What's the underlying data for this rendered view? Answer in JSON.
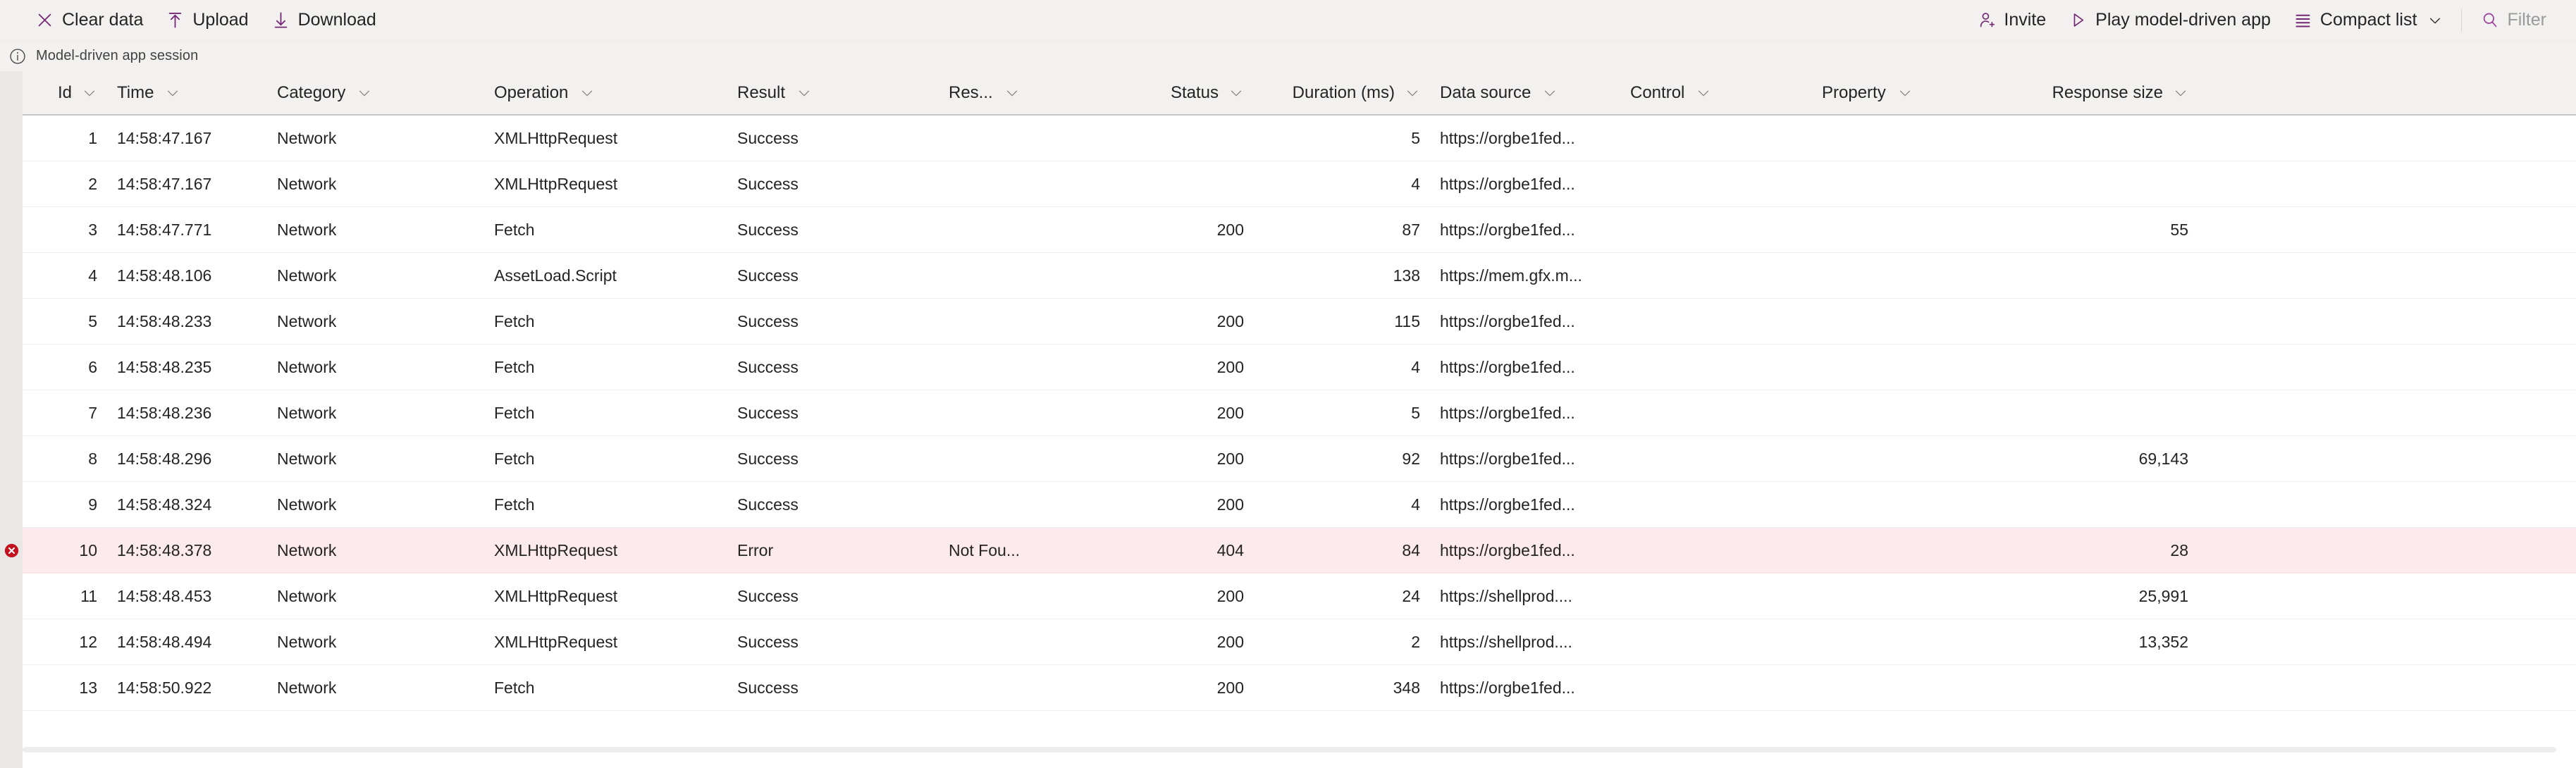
{
  "commandbar": {
    "left_items": [
      {
        "label": "Clear data",
        "icon": "clear-data-icon",
        "disabled": false
      },
      {
        "label": "Upload",
        "icon": "upload-icon",
        "disabled": false
      },
      {
        "label": "Download",
        "icon": "download-icon",
        "disabled": false
      }
    ],
    "right_items": [
      {
        "label": "Invite",
        "icon": "invite-person-add-icon",
        "disabled": false,
        "chevron": false
      },
      {
        "label": "Play model-driven app",
        "icon": "play-icon",
        "disabled": false,
        "chevron": false
      },
      {
        "label": "Compact list",
        "icon": "list-icon",
        "disabled": false,
        "chevron": true
      },
      {
        "label": "Filter",
        "icon": "search-icon",
        "disabled": true,
        "chevron": false
      }
    ]
  },
  "session": {
    "icon": "info-icon",
    "label": "Model-driven app session"
  },
  "grid": {
    "columns": [
      {
        "key": "id",
        "label": "Id",
        "align": "right",
        "class": "c-id"
      },
      {
        "key": "time",
        "label": "Time",
        "align": "left",
        "class": "c-time"
      },
      {
        "key": "category",
        "label": "Category",
        "align": "left",
        "class": "c-cat"
      },
      {
        "key": "operation",
        "label": "Operation",
        "align": "left",
        "class": "c-op"
      },
      {
        "key": "result",
        "label": "Result",
        "align": "left",
        "class": "c-result"
      },
      {
        "key": "res",
        "label": "Res...",
        "align": "left",
        "class": "c-res"
      },
      {
        "key": "status",
        "label": "Status",
        "align": "right",
        "class": "c-status"
      },
      {
        "key": "duration",
        "label": "Duration (ms)",
        "align": "right",
        "class": "c-dur"
      },
      {
        "key": "source",
        "label": "Data source",
        "align": "left",
        "class": "c-src"
      },
      {
        "key": "control",
        "label": "Control",
        "align": "left",
        "class": "c-ctrl"
      },
      {
        "key": "property",
        "label": "Property",
        "align": "left",
        "class": "c-prop"
      },
      {
        "key": "size",
        "label": "Response size",
        "align": "right",
        "class": "c-size"
      }
    ],
    "rows": [
      {
        "state": "ok",
        "id": "1",
        "time": "14:58:47.167",
        "category": "Network",
        "operation": "XMLHttpRequest",
        "result": "Success",
        "res": "",
        "status": "",
        "duration": "5",
        "source": "https://orgbe1fed...",
        "control": "",
        "property": "",
        "size": ""
      },
      {
        "state": "ok",
        "id": "2",
        "time": "14:58:47.167",
        "category": "Network",
        "operation": "XMLHttpRequest",
        "result": "Success",
        "res": "",
        "status": "",
        "duration": "4",
        "source": "https://orgbe1fed...",
        "control": "",
        "property": "",
        "size": ""
      },
      {
        "state": "ok",
        "id": "3",
        "time": "14:58:47.771",
        "category": "Network",
        "operation": "Fetch",
        "result": "Success",
        "res": "",
        "status": "200",
        "duration": "87",
        "source": "https://orgbe1fed...",
        "control": "",
        "property": "",
        "size": "55"
      },
      {
        "state": "ok",
        "id": "4",
        "time": "14:58:48.106",
        "category": "Network",
        "operation": "AssetLoad.Script",
        "result": "Success",
        "res": "",
        "status": "",
        "duration": "138",
        "source": "https://mem.gfx.m...",
        "control": "",
        "property": "",
        "size": ""
      },
      {
        "state": "ok",
        "id": "5",
        "time": "14:58:48.233",
        "category": "Network",
        "operation": "Fetch",
        "result": "Success",
        "res": "",
        "status": "200",
        "duration": "115",
        "source": "https://orgbe1fed...",
        "control": "",
        "property": "",
        "size": ""
      },
      {
        "state": "ok",
        "id": "6",
        "time": "14:58:48.235",
        "category": "Network",
        "operation": "Fetch",
        "result": "Success",
        "res": "",
        "status": "200",
        "duration": "4",
        "source": "https://orgbe1fed...",
        "control": "",
        "property": "",
        "size": ""
      },
      {
        "state": "ok",
        "id": "7",
        "time": "14:58:48.236",
        "category": "Network",
        "operation": "Fetch",
        "result": "Success",
        "res": "",
        "status": "200",
        "duration": "5",
        "source": "https://orgbe1fed...",
        "control": "",
        "property": "",
        "size": ""
      },
      {
        "state": "ok",
        "id": "8",
        "time": "14:58:48.296",
        "category": "Network",
        "operation": "Fetch",
        "result": "Success",
        "res": "",
        "status": "200",
        "duration": "92",
        "source": "https://orgbe1fed...",
        "control": "",
        "property": "",
        "size": "69,143"
      },
      {
        "state": "ok",
        "id": "9",
        "time": "14:58:48.324",
        "category": "Network",
        "operation": "Fetch",
        "result": "Success",
        "res": "",
        "status": "200",
        "duration": "4",
        "source": "https://orgbe1fed...",
        "control": "",
        "property": "",
        "size": ""
      },
      {
        "state": "error",
        "id": "10",
        "time": "14:58:48.378",
        "category": "Network",
        "operation": "XMLHttpRequest",
        "result": "Error",
        "res": "Not Fou...",
        "status": "404",
        "duration": "84",
        "source": "https://orgbe1fed...",
        "control": "",
        "property": "",
        "size": "28"
      },
      {
        "state": "ok",
        "id": "11",
        "time": "14:58:48.453",
        "category": "Network",
        "operation": "XMLHttpRequest",
        "result": "Success",
        "res": "",
        "status": "200",
        "duration": "24",
        "source": "https://shellprod....",
        "control": "",
        "property": "",
        "size": "25,991"
      },
      {
        "state": "ok",
        "id": "12",
        "time": "14:58:48.494",
        "category": "Network",
        "operation": "XMLHttpRequest",
        "result": "Success",
        "res": "",
        "status": "200",
        "duration": "2",
        "source": "https://shellprod....",
        "control": "",
        "property": "",
        "size": "13,352"
      },
      {
        "state": "ok",
        "id": "13",
        "time": "14:58:50.922",
        "category": "Network",
        "operation": "Fetch",
        "result": "Success",
        "res": "",
        "status": "200",
        "duration": "348",
        "source": "https://orgbe1fed...",
        "control": "",
        "property": "",
        "size": ""
      }
    ]
  },
  "colors": {
    "accent": "#742774",
    "error_row_bg": "#fdeaec",
    "error_badge": "#c4111e",
    "toolbar_bg": "#f2f1f0",
    "disabled_text": "#9a9a9a"
  }
}
